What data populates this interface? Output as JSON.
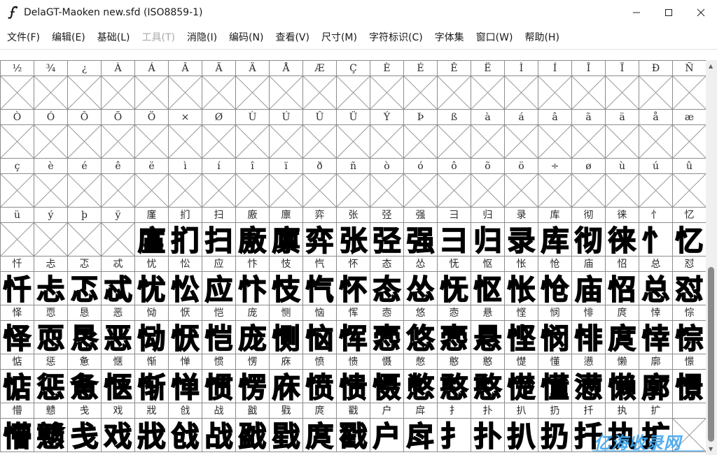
{
  "window": {
    "title": "DelaGT-Maoken  new.sfd (ISO8859-1)",
    "minimize_glyph": "—",
    "maximize_glyph": "☐",
    "close_glyph": "✕"
  },
  "menu": [
    {
      "label": "文件(F)",
      "enabled": true
    },
    {
      "label": "编辑(E)",
      "enabled": true
    },
    {
      "label": "基础(L)",
      "enabled": true
    },
    {
      "label": "工具(T)",
      "enabled": false
    },
    {
      "label": "消隐(I)",
      "enabled": true
    },
    {
      "label": "编码(N)",
      "enabled": true
    },
    {
      "label": "查看(V)",
      "enabled": true
    },
    {
      "label": "尺寸(M)",
      "enabled": true
    },
    {
      "label": "字符标识(C)",
      "enabled": true
    },
    {
      "label": "字体集",
      "enabled": true
    },
    {
      "label": "窗口(W)",
      "enabled": true
    },
    {
      "label": "帮助(H)",
      "enabled": true
    }
  ],
  "glyph_rows": [
    {
      "labels": [
        "½",
        "¾",
        "¿",
        "À",
        "Á",
        "Â",
        "Ã",
        "Ä",
        "Å",
        "Æ",
        "Ç",
        "È",
        "É",
        "Ê",
        "Ë",
        "Ì",
        "Í",
        "Î",
        "Ï",
        "Ð",
        "Ñ"
      ],
      "filled": []
    },
    {
      "labels": [
        "Ò",
        "Ó",
        "Ô",
        "Õ",
        "Ö",
        "×",
        "Ø",
        "Ù",
        "Ú",
        "Û",
        "Ü",
        "Ý",
        "Þ",
        "ß",
        "à",
        "á",
        "â",
        "ã",
        "ä",
        "å",
        "æ"
      ],
      "filled": []
    },
    {
      "labels": [
        "ç",
        "è",
        "é",
        "ê",
        "ë",
        "ì",
        "í",
        "î",
        "ï",
        "ð",
        "ñ",
        "ò",
        "ó",
        "ô",
        "õ",
        "ö",
        "÷",
        "ø",
        "ù",
        "ú",
        "û"
      ],
      "filled": []
    },
    {
      "labels": [
        "ü",
        "ý",
        "þ",
        "ÿ",
        "廑",
        "扪",
        "扫",
        "廒",
        "廪",
        "弈",
        "张",
        "弪",
        "强",
        "彐",
        "归",
        "录",
        "库",
        "彻",
        "徕",
        "忄",
        "忆"
      ],
      "filled": [
        4,
        5,
        6,
        7,
        8,
        9,
        10,
        11,
        12,
        13,
        14,
        15,
        16,
        17,
        18,
        19,
        20
      ]
    },
    {
      "labels": [
        "忏",
        "忐",
        "忑",
        "忒",
        "忧",
        "忪",
        "应",
        "忭",
        "忮",
        "忾",
        "怀",
        "态",
        "怂",
        "怃",
        "怄",
        "怅",
        "怆",
        "庙",
        "怊",
        "总",
        "怼"
      ],
      "filled": [
        0,
        1,
        2,
        3,
        4,
        5,
        6,
        7,
        8,
        9,
        10,
        11,
        12,
        13,
        14,
        15,
        16,
        17,
        18,
        19,
        20
      ]
    },
    {
      "labels": [
        "怿",
        "恧",
        "恳",
        "恶",
        "恸",
        "恹",
        "恺",
        "庞",
        "恻",
        "恼",
        "恽",
        "悫",
        "悠",
        "悫",
        "悬",
        "悭",
        "悯",
        "悱",
        "庹",
        "悻",
        "悰"
      ],
      "filled": [
        0,
        1,
        2,
        3,
        4,
        5,
        6,
        7,
        8,
        9,
        10,
        11,
        12,
        13,
        14,
        15,
        16,
        17,
        18,
        19,
        20
      ]
    },
    {
      "labels": [
        "惦",
        "惩",
        "惫",
        "惬",
        "惭",
        "惮",
        "惯",
        "愣",
        "庥",
        "愤",
        "愦",
        "慑",
        "憋",
        "憨",
        "憨",
        "憷",
        "懂",
        "懑",
        "懒",
        "廓",
        "憬"
      ],
      "filled": [
        0,
        1,
        2,
        3,
        4,
        5,
        6,
        7,
        8,
        9,
        10,
        11,
        12,
        13,
        14,
        15,
        16,
        17,
        18,
        19,
        20
      ]
    },
    {
      "labels": [
        "懵",
        "戆",
        "戋",
        "戏",
        "戕",
        "戗",
        "战",
        "戤",
        "戥",
        "庹",
        "戳",
        "户",
        "戽",
        "扌",
        "扑",
        "扒",
        "扔",
        "扦",
        "执",
        "扩",
        ""
      ],
      "filled": [
        0,
        1,
        2,
        3,
        4,
        5,
        6,
        7,
        8,
        9,
        10,
        11,
        12,
        13,
        14,
        15,
        16,
        17,
        18,
        19
      ]
    }
  ],
  "watermark": "亿海收录网"
}
